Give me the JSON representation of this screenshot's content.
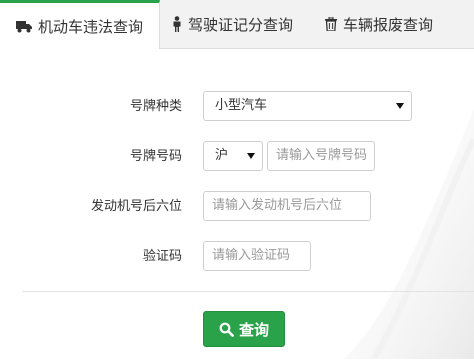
{
  "tabs": [
    {
      "label": "机动车违法查询",
      "icon": "truck-icon",
      "active": true
    },
    {
      "label": "驾驶证记分查询",
      "icon": "person-icon",
      "active": false
    },
    {
      "label": "车辆报废查询",
      "icon": "trash-icon",
      "active": false
    }
  ],
  "form": {
    "plate_type": {
      "label": "号牌种类",
      "value": "小型汽车"
    },
    "plate_number": {
      "label": "号牌号码",
      "prefix": "沪",
      "placeholder": "请输入号牌号码"
    },
    "engine": {
      "label": "发动机号后六位",
      "placeholder": "请输入发动机号后六位"
    },
    "captcha": {
      "label": "验证码",
      "placeholder": "请输入验证码"
    }
  },
  "submit": {
    "label": "查询",
    "icon": "search-icon"
  },
  "colors": {
    "accent": "#2aa24a",
    "tab_bar": "#f2f2f2",
    "border": "#cfcfcf"
  }
}
